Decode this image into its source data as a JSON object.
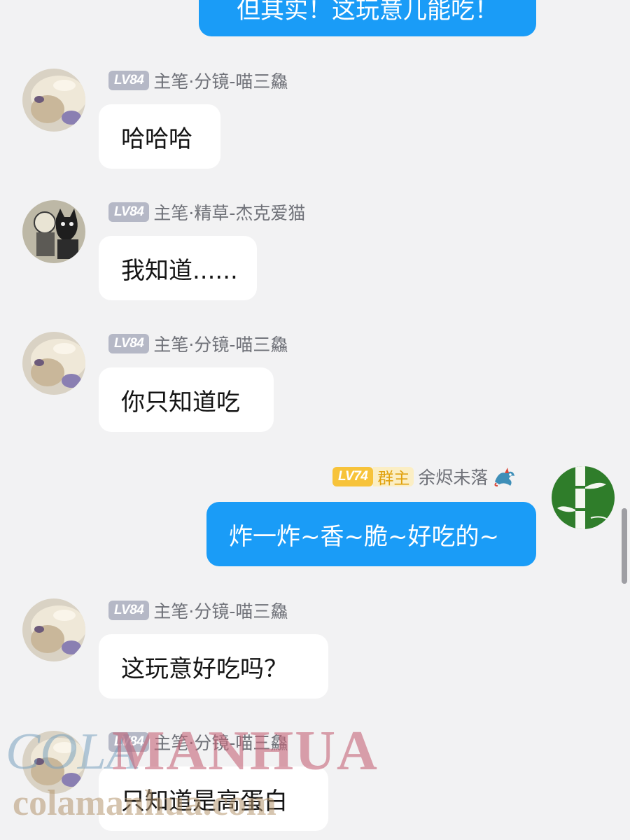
{
  "colors": {
    "background": "#f2f2f3",
    "incoming_bubble": "#ffffff",
    "outgoing_bubble": "#1a9cf7",
    "level_badge": "#b5b8c6",
    "owner_badge": "#f7c33a"
  },
  "messages": [
    {
      "direction": "outgoing",
      "text": "但其实！这玩意儿能吃！"
    },
    {
      "direction": "incoming",
      "level": "LV84",
      "sender": "主笔·分镜-喵三鱻",
      "avatar": "cat-photo-avatar",
      "text": "哈哈哈"
    },
    {
      "direction": "incoming",
      "level": "LV84",
      "sender": "主笔·精草-杰克爱猫",
      "avatar": "sketch-cat-avatar",
      "text": "我知道......"
    },
    {
      "direction": "incoming",
      "level": "LV84",
      "sender": "主笔·分镜-喵三鱻",
      "avatar": "cat-photo-avatar",
      "text": "你只知道吃"
    },
    {
      "direction": "outgoing",
      "level": "LV74",
      "role": "群主",
      "sender": "余烬未落",
      "avatar": "bamboo-avatar",
      "sender_icon": "dragon-icon",
      "text": "炸一炸~香~脆~好吃的~"
    },
    {
      "direction": "incoming",
      "level": "LV84",
      "sender": "主笔·分镜-喵三鱻",
      "avatar": "cat-photo-avatar",
      "text": "这玩意好吃吗？"
    },
    {
      "direction": "incoming",
      "level": "LV84",
      "sender": "主笔·分镜-喵三鱻",
      "avatar": "cat-photo-avatar",
      "text": "只知道是高蛋白"
    }
  ],
  "watermark": {
    "prefix": "COLA",
    "brand": "MANHUA",
    "url": "colamanhua.com"
  }
}
